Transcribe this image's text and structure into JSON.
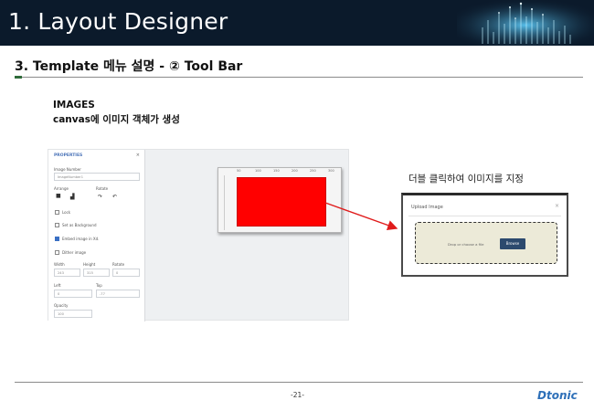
{
  "header": {
    "title": "1. Layout Designer"
  },
  "subtitle": "3. Template 메뉴 설명 - ② Tool Bar",
  "caption": {
    "line1": "IMAGES",
    "line2": "canvas에 이미지 객체가 생성"
  },
  "properties_panel": {
    "title": "PROPERTIES",
    "close": "×",
    "image_number_label": "Image Number",
    "image_number_value": "ImageNumber1",
    "arrange_label": "Arrange",
    "rotate_label": "Rotate",
    "lock_label": "Lock",
    "set_bg_label": "Set as Background",
    "embed_label": "Embed image in Xd.",
    "embed_checked": true,
    "dither_label": "Dither image",
    "width_label": "Width",
    "height_label": "Height",
    "rotate2_label": "Rotate",
    "width_value": "243",
    "height_value": "315",
    "rotate_value": "0",
    "left_label": "Left",
    "top_label": "Top",
    "left_value": "0",
    "top_value": "-77",
    "opacity_label": "Opacity",
    "opacity_value": "100"
  },
  "canvas": {
    "ruler_ticks": [
      "50",
      "100",
      "150",
      "200",
      "250",
      "300"
    ],
    "image_color": "#ff0000"
  },
  "double_click_label": "더블 클릭하여 이미지를 지정",
  "upload_dialog": {
    "title": "Upload Image",
    "close": "×",
    "drop_text": "Drop or choose a file",
    "browse_label": "Browse"
  },
  "footer": {
    "page": "-21-",
    "logo": "Dtonic"
  },
  "colors": {
    "header_bg": "#0b1a2b",
    "accent_blue": "#2d6fb8",
    "arrow_red": "#e01b1b"
  }
}
